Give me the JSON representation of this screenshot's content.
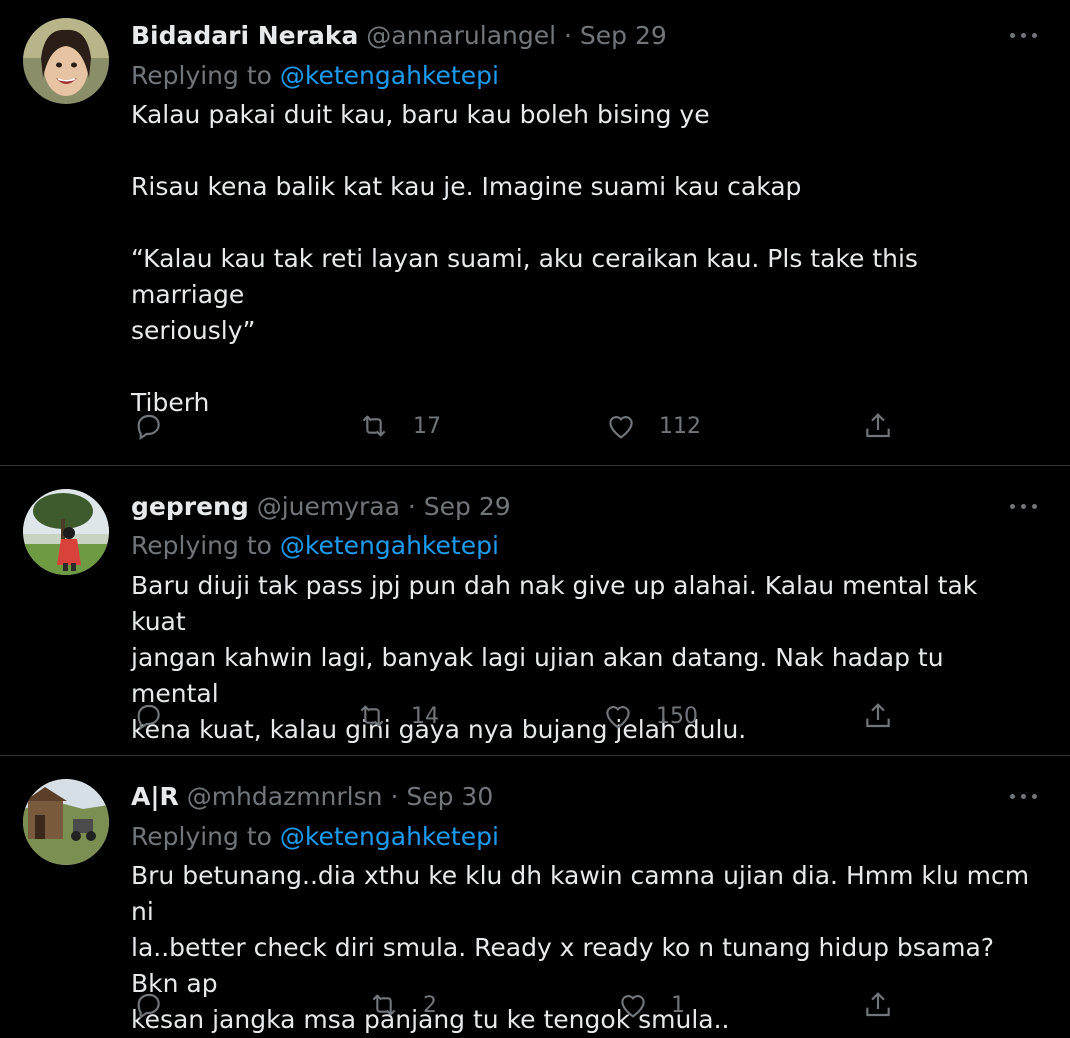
{
  "tweets": [
    {
      "name": "Bidadari Neraka",
      "handle": "@annarulangel",
      "separator": "·",
      "date": "Sep 29",
      "replying_prefix": "Replying to",
      "replying_to": "@ketengahketepi",
      "text": "Kalau pakai duit kau, baru kau boleh bising ye\n\nRisau kena balik kat kau je. Imagine suami kau cakap\n\n“Kalau kau tak reti layan suami, aku ceraikan kau. Pls take this marriage\nseriously”\n\nTiberh",
      "retweets": "17",
      "likes": "112",
      "avatar_icon": "profile-photo"
    },
    {
      "name": "gepreng",
      "handle": "@juemyraa",
      "separator": "·",
      "date": "Sep 29",
      "replying_prefix": "Replying to",
      "replying_to": "@ketengahketepi",
      "text": "Baru diuji tak pass jpj pun dah nak give up alahai. Kalau mental tak kuat\njangan kahwin lagi, banyak lagi ujian akan datang. Nak hadap tu mental\nkena kuat, kalau gini gaya nya bujang jelah dulu.",
      "retweets": "14",
      "likes": "150",
      "avatar_icon": "profile-photo"
    },
    {
      "name": "A|R",
      "handle": "@mhdazmnrlsn",
      "separator": "·",
      "date": "Sep 30",
      "replying_prefix": "Replying to",
      "replying_to": "@ketengahketepi",
      "text": "Bru betunang..dia xthu ke klu dh kawin camna ujian dia. Hmm klu mcm ni\nla..better check diri smula. Ready x ready ko n tunang hidup bsama? Bkn ap\nkesan jangka msa panjang tu ke tengok smula..",
      "retweets": "2",
      "likes": "1",
      "avatar_icon": "profile-photo"
    }
  ],
  "icons": {
    "reply": "reply-icon",
    "retweet": "retweet-icon",
    "like": "heart-icon",
    "share": "share-icon",
    "more": "more-icon"
  },
  "colors": {
    "background": "#000000",
    "text": "#e7e9ea",
    "muted": "#71767b",
    "link": "#1d9bf0",
    "divider": "#2f3336"
  }
}
